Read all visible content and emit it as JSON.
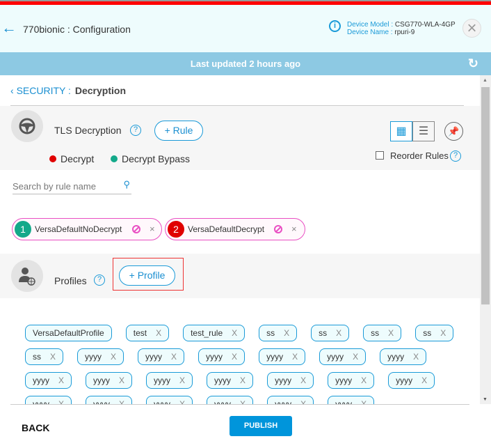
{
  "header": {
    "title": "770bionic : Configuration",
    "device_model_label": "Device Model :",
    "device_model": "CSG770-WLA-4GP",
    "device_name_label": "Device Name :",
    "device_name": "rpuri-9"
  },
  "status_bar": {
    "text": "Last updated 2 hours ago"
  },
  "breadcrumb": {
    "section": "SECURITY :",
    "current": "Decryption"
  },
  "tls": {
    "title": "TLS Decryption",
    "add_rule": "Rule",
    "legend": [
      {
        "label": "Decrypt",
        "color": "#e00000"
      },
      {
        "label": "Decrypt Bypass",
        "color": "#13a98a"
      }
    ],
    "reorder_label": "Reorder Rules",
    "reorder_checked": false,
    "view": "grid"
  },
  "search": {
    "placeholder": "Search by rule name"
  },
  "rules": [
    {
      "num": "1",
      "name": "VersaDefaultNoDecrypt",
      "color": "#13a98a"
    },
    {
      "num": "2",
      "name": "VersaDefaultDecrypt",
      "color": "#e00000"
    }
  ],
  "profiles": {
    "title": "Profiles",
    "add_profile": "Profile",
    "items": [
      {
        "name": "VersaDefaultProfile",
        "removable": false
      },
      {
        "name": "test",
        "removable": true
      },
      {
        "name": "test_rule",
        "removable": true
      },
      {
        "name": "ss",
        "removable": true
      },
      {
        "name": "ss",
        "removable": true
      },
      {
        "name": "ss",
        "removable": true
      },
      {
        "name": "ss",
        "removable": true
      },
      {
        "name": "ss",
        "removable": true
      },
      {
        "name": "yyyy",
        "removable": true
      },
      {
        "name": "yyyy",
        "removable": true
      },
      {
        "name": "yyyy",
        "removable": true
      },
      {
        "name": "yyyy",
        "removable": true
      },
      {
        "name": "yyyy",
        "removable": true
      },
      {
        "name": "yyyy",
        "removable": true
      },
      {
        "name": "yyyy",
        "removable": true
      },
      {
        "name": "yyyy",
        "removable": true
      },
      {
        "name": "yyyy",
        "removable": true
      },
      {
        "name": "yyyy",
        "removable": true
      },
      {
        "name": "yyyy",
        "removable": true
      },
      {
        "name": "yyyy",
        "removable": true
      },
      {
        "name": "yyyy",
        "removable": true
      },
      {
        "name": "yyyy",
        "removable": true
      },
      {
        "name": "yyyy",
        "removable": true
      },
      {
        "name": "yyyy",
        "removable": true
      },
      {
        "name": "yyyy",
        "removable": true
      },
      {
        "name": "yyyy",
        "removable": true
      },
      {
        "name": "yyyy",
        "removable": true
      }
    ]
  },
  "footer": {
    "back": "BACK",
    "publish": "PUBLISH"
  }
}
